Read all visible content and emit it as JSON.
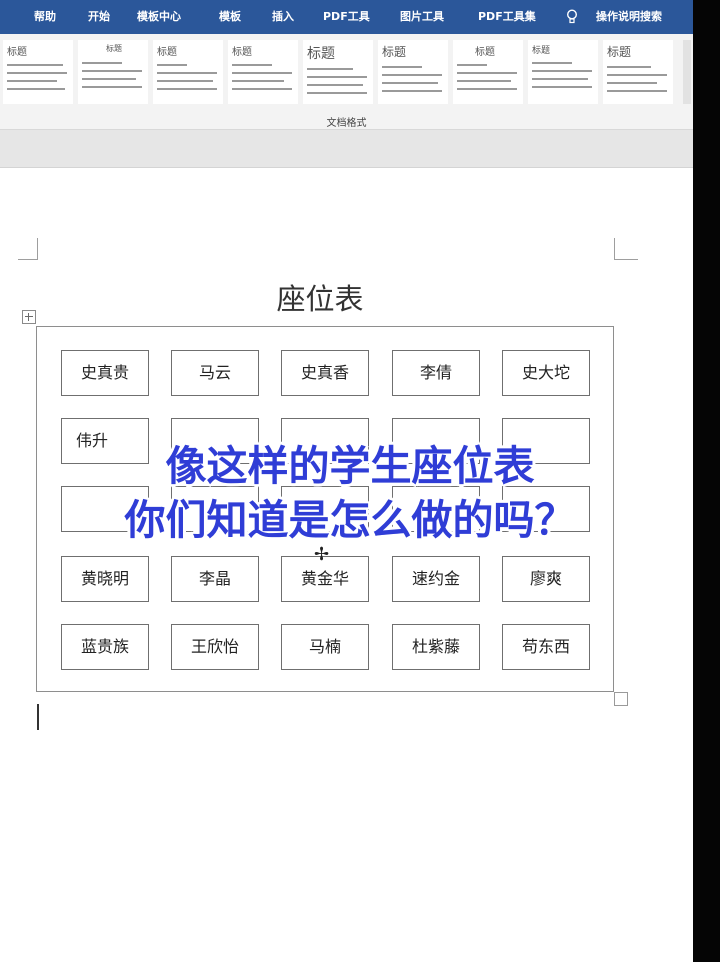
{
  "ribbon": {
    "tabs": [
      "帮助",
      "开始",
      "模板中心",
      "模板",
      "插入",
      "PDF工具",
      "图片工具",
      "PDF工具集",
      "操作说明搜索"
    ],
    "search_icon": "lightbulb-icon",
    "style_gallery": {
      "titles": [
        "标题",
        "标题",
        "标题",
        "标题",
        "标题",
        "标题",
        "标题",
        "标题",
        "标题"
      ],
      "group_label": "文档格式"
    }
  },
  "document": {
    "title": "座位表",
    "seats": [
      [
        "史真贵",
        "马云",
        "史真香",
        "李倩",
        "史大坨"
      ],
      [
        "伟升",
        "",
        "",
        "",
        ""
      ],
      [
        "",
        "",
        "",
        "",
        ""
      ],
      [
        "黄晓明",
        "李晶",
        "黄金华",
        "速约金",
        "廖爽"
      ],
      [
        "蓝贵族",
        "王欣怡",
        "马楠",
        "杜紫藤",
        "苟东西"
      ]
    ]
  },
  "overlay": {
    "caption_line1": "像这样的学生座位表",
    "caption_line2": "你们知道是怎么做的吗？"
  }
}
